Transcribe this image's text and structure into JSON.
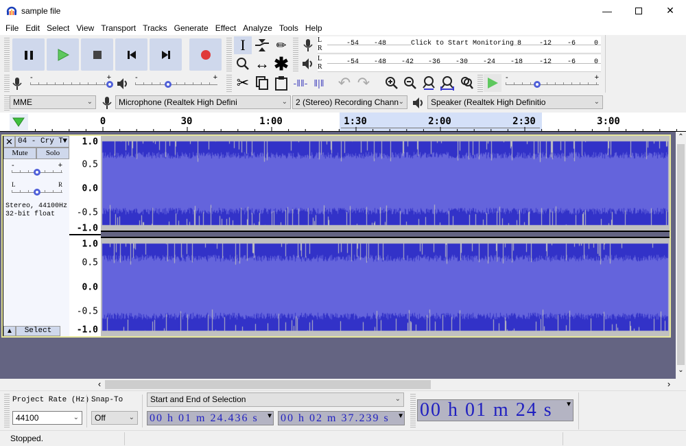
{
  "window": {
    "title": "sample file",
    "minimize_icon": "minimize-icon",
    "maximize_icon": "maximize-icon",
    "close_icon": "close-icon"
  },
  "menu": [
    "File",
    "Edit",
    "Select",
    "View",
    "Transport",
    "Tracks",
    "Generate",
    "Effect",
    "Analyze",
    "Tools",
    "Help"
  ],
  "transport": {
    "buttons": [
      "pause",
      "play",
      "stop",
      "skip-to-start",
      "skip-to-end",
      "record"
    ]
  },
  "tools": [
    "selection-tool",
    "envelope-tool",
    "draw-tool",
    "zoom-tool",
    "time-shift-tool",
    "multi-tool"
  ],
  "meters": {
    "record": {
      "channels": [
        "L",
        "R"
      ],
      "ticks": [
        "-54",
        "-48",
        "8",
        "-12",
        "-6",
        "0"
      ],
      "prompt": "Click to Start Monitoring"
    },
    "playback": {
      "channels": [
        "L",
        "R"
      ],
      "ticks": [
        "-54",
        "-48",
        "-42",
        "-36",
        "-30",
        "-24",
        "-18",
        "-12",
        "-6",
        "0"
      ]
    }
  },
  "mixer": {
    "record_volume": 1.0,
    "playback_volume": 0.5,
    "min": "-",
    "max": "+"
  },
  "play_at_speed": {
    "value": 0.35,
    "min": "-",
    "max": "+"
  },
  "devices": {
    "host": "MME",
    "microphone": "Microphone (Realtek High Defini",
    "channels": "2 (Stereo) Recording Chann",
    "speaker": "Speaker (Realtek High Definitio"
  },
  "ruler": {
    "labels": [
      "0",
      "30",
      "1:00",
      "1:30",
      "2:00",
      "2:30",
      "3:00"
    ]
  },
  "track": {
    "name": "04 - Cry T",
    "mute": "Mute",
    "solo": "Solo",
    "gain_min": "-",
    "gain_max": "+",
    "gain": 0.5,
    "pan_left": "L",
    "pan_right": "R",
    "pan": 0.5,
    "info_line1": "Stereo, 44100Hz",
    "info_line2": "32-bit float",
    "select": "Select",
    "scale": [
      "1.0",
      "0.5",
      "0.0",
      "-0.5",
      "-1.0"
    ]
  },
  "selection_toolbar": {
    "project_rate_label": "Project Rate (Hz)",
    "project_rate": "44100",
    "snap_to_label": "Snap-To",
    "snap_to": "Off",
    "selection_mode": "Start and End of Selection",
    "start": {
      "hh": "00",
      "h": "h",
      "mm": "01",
      "m": "m",
      "ss": "24.436",
      "s": "s"
    },
    "end": {
      "hh": "00",
      "h": "h",
      "mm": "02",
      "m": "m",
      "ss": "37.239",
      "s": "s"
    }
  },
  "time_display": {
    "hh": "00",
    "h": "h",
    "mm": "01",
    "m": "m",
    "ss": "24",
    "s": "s"
  },
  "status": "Stopped."
}
